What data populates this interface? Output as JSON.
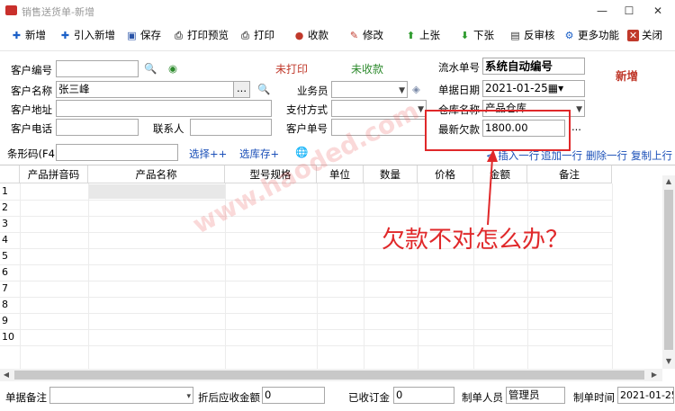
{
  "window": {
    "title": "销售送货单-新增",
    "min": "—",
    "max": "☐",
    "close": "✕"
  },
  "toolbar": {
    "new": "新增",
    "import_new": "引入新增",
    "save": "保存",
    "print_preview": "打印预览",
    "print": "打印",
    "collect": "收款",
    "modify": "修改",
    "prev": "上张",
    "next": "下张",
    "reverse_audit": "反审核",
    "more": "更多功能",
    "close": "关闭"
  },
  "form": {
    "customer_code_label": "客户编号",
    "customer_code": "",
    "customer_name_label": "客户名称",
    "customer_name": "张三峰",
    "customer_addr_label": "客户地址",
    "customer_addr": "",
    "customer_phone_label": "客户电话",
    "customer_phone": "",
    "contact_label": "联系人",
    "contact": "",
    "print_status": "未打印",
    "collect_status": "未收款",
    "salesman_label": "业务员",
    "salesman": "",
    "pay_method_label": "支付方式",
    "pay_method": "",
    "customer_order_label": "客户单号",
    "customer_order": "",
    "serial_label": "流水单号",
    "serial": "系统自动编号",
    "date_label": "单据日期",
    "date": "2021-01-25",
    "warehouse_label": "仓库名称",
    "warehouse": "产品仓库",
    "latest_debt_label": "最新欠款",
    "latest_debt": "1800.00",
    "mode_badge": "新增",
    "ellipsis": "...",
    "ellipsis2": "..."
  },
  "barcode_row": {
    "barcode_label": "条形码(F4)",
    "barcode": "",
    "select_pp": "选择++",
    "select_stock": "选库存+",
    "insert_row": "< 插入一行",
    "append_row": "追加一行",
    "delete_row": "删除一行",
    "copy_row": "复制上行"
  },
  "grid": {
    "columns": [
      "产品拼音码",
      "产品名称",
      "型号规格",
      "单位",
      "数量",
      "价格",
      "金额",
      "备注"
    ],
    "row_numbers": [
      "1",
      "2",
      "3",
      "4",
      "5",
      "6",
      "7",
      "8",
      "9",
      "10"
    ]
  },
  "footer": {
    "remark_label": "单据备注",
    "remark": "",
    "discount_label": "折后应收金额",
    "discount": "0",
    "received_label": "已收订金",
    "received": "0",
    "maker_label": "制单人员",
    "maker": "管理员",
    "make_time_label": "制单时间",
    "make_time": "2021-01-25"
  },
  "annotation": {
    "text": "欠款不对怎么办？",
    "watermark": "www.haoded.com"
  },
  "colors": {
    "accent_red": "#e0282a",
    "status_red": "#c0392b",
    "status_green": "#2e8b2e",
    "link_blue": "#1a4fb8"
  }
}
